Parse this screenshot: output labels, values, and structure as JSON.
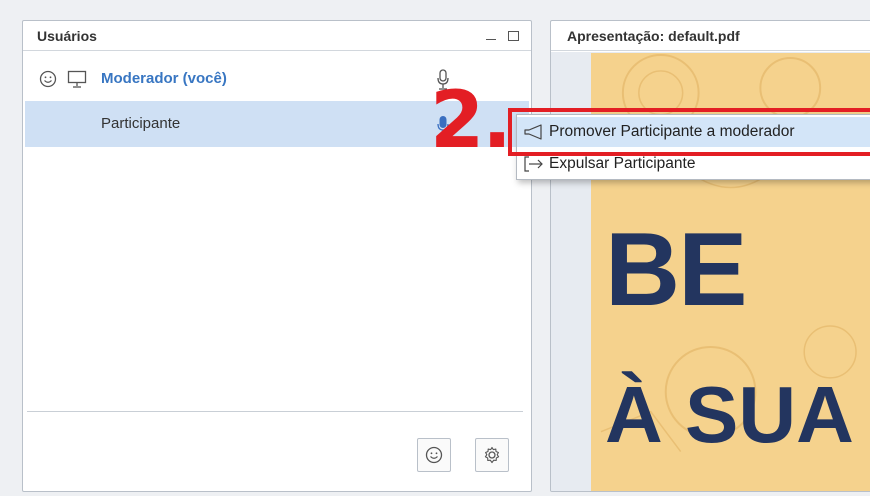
{
  "users_panel": {
    "title": "Usuários",
    "moderator": {
      "name": "Moderador (você)",
      "name_color": "#3876c2"
    },
    "participant": {
      "name": "Participante",
      "selected": true
    },
    "icons": [
      "smile-icon",
      "presenter-icon",
      "microphone-icon",
      "settings-gear-icon",
      "minimize-icon",
      "maximize-icon"
    ]
  },
  "presentation_panel": {
    "title": "Apresentação: default.pdf",
    "slide": {
      "line1": "BE",
      "line2": "À SUA",
      "background": "#f5d28d",
      "text_color": "#23355f"
    }
  },
  "context_menu": {
    "items": [
      {
        "label": "Promover Participante a moderador",
        "icon": "megaphone-icon",
        "highlighted": true
      },
      {
        "label": "Expulsar Participante",
        "icon": "logout-arrow-icon",
        "highlighted": false
      }
    ]
  },
  "annotation": {
    "step": "2.",
    "color": "#e31e24"
  }
}
